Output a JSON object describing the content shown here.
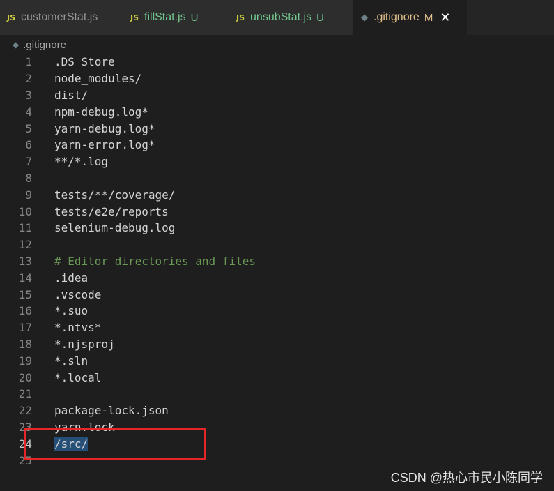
{
  "tabs": [
    {
      "icon": "JS",
      "label": "customerStat.js",
      "status": ""
    },
    {
      "icon": "JS",
      "label": "fillStat.js",
      "status": "U"
    },
    {
      "icon": "JS",
      "label": "unsubStat.js",
      "status": "U"
    },
    {
      "icon": "gitignore-icon",
      "label": ".gitignore",
      "status": "M",
      "close": "✕"
    }
  ],
  "breadcrumb": {
    "file": ".gitignore"
  },
  "editor": {
    "lines": [
      {
        "num": "1",
        "text": ".DS_Store"
      },
      {
        "num": "2",
        "text": "node_modules/"
      },
      {
        "num": "3",
        "text": "dist/"
      },
      {
        "num": "4",
        "text": "npm-debug.log*"
      },
      {
        "num": "5",
        "text": "yarn-debug.log*"
      },
      {
        "num": "6",
        "text": "yarn-error.log*"
      },
      {
        "num": "7",
        "text": "**/*.log"
      },
      {
        "num": "8",
        "text": ""
      },
      {
        "num": "9",
        "text": "tests/**/coverage/"
      },
      {
        "num": "10",
        "text": "tests/e2e/reports"
      },
      {
        "num": "11",
        "text": "selenium-debug.log"
      },
      {
        "num": "12",
        "text": ""
      },
      {
        "num": "13",
        "text": "# Editor directories and files"
      },
      {
        "num": "14",
        "text": ".idea"
      },
      {
        "num": "15",
        "text": ".vscode"
      },
      {
        "num": "16",
        "text": "*.suo"
      },
      {
        "num": "17",
        "text": "*.ntvs*"
      },
      {
        "num": "18",
        "text": "*.njsproj"
      },
      {
        "num": "19",
        "text": "*.sln"
      },
      {
        "num": "20",
        "text": "*.local"
      },
      {
        "num": "21",
        "text": ""
      },
      {
        "num": "22",
        "text": "package-lock.json"
      },
      {
        "num": "23",
        "text": "yarn.lock"
      },
      {
        "num": "24",
        "text": "/src/"
      },
      {
        "num": "25",
        "text": ""
      }
    ]
  },
  "watermark": "CSDN @热心市民小陈同学",
  "colors": {
    "selection": "#264f78",
    "annotation_box": "#e8262a",
    "comment": "#6a9955",
    "modified": "#e2c08d",
    "untracked": "#73c991"
  }
}
